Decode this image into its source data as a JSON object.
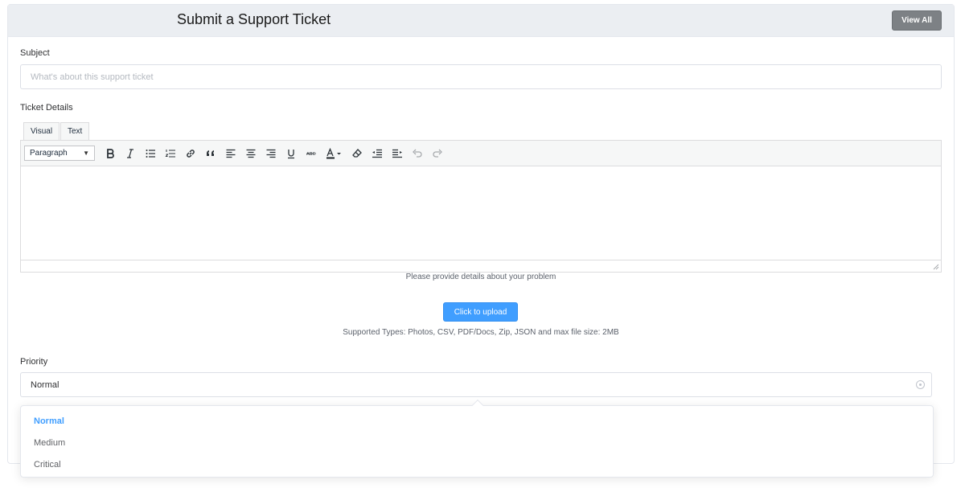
{
  "header": {
    "title": "Submit a Support Ticket",
    "view_all_label": "View All"
  },
  "subject": {
    "label": "Subject",
    "value": "",
    "placeholder": "What's about this support ticket"
  },
  "details": {
    "label": "Ticket Details",
    "tabs": [
      {
        "label": "Visual"
      },
      {
        "label": "Text"
      }
    ],
    "format_select": "Paragraph",
    "toolbar_icons": [
      "bold-icon",
      "italic-icon",
      "bullet-list-icon",
      "numbered-list-icon",
      "link-icon",
      "blockquote-icon",
      "align-left-icon",
      "align-center-icon",
      "align-right-icon",
      "underline-icon",
      "strikethrough-icon",
      "text-color-icon",
      "clear-formatting-icon",
      "outdent-icon",
      "indent-icon",
      "undo-icon",
      "redo-icon"
    ],
    "help_text": "Please provide details about your problem"
  },
  "upload": {
    "button_label": "Click to upload",
    "supported_text": "Supported Types: Photos, CSV, PDF/Docs, Zip, JSON and max file size: 2MB"
  },
  "priority": {
    "label": "Priority",
    "selected": "Normal",
    "options": [
      {
        "label": "Normal",
        "selected": true
      },
      {
        "label": "Medium",
        "selected": false
      },
      {
        "label": "Critical",
        "selected": false
      }
    ]
  },
  "colors": {
    "primary": "#409eff",
    "header_bg": "#ebeef2",
    "view_all_bg": "#7d8185"
  }
}
